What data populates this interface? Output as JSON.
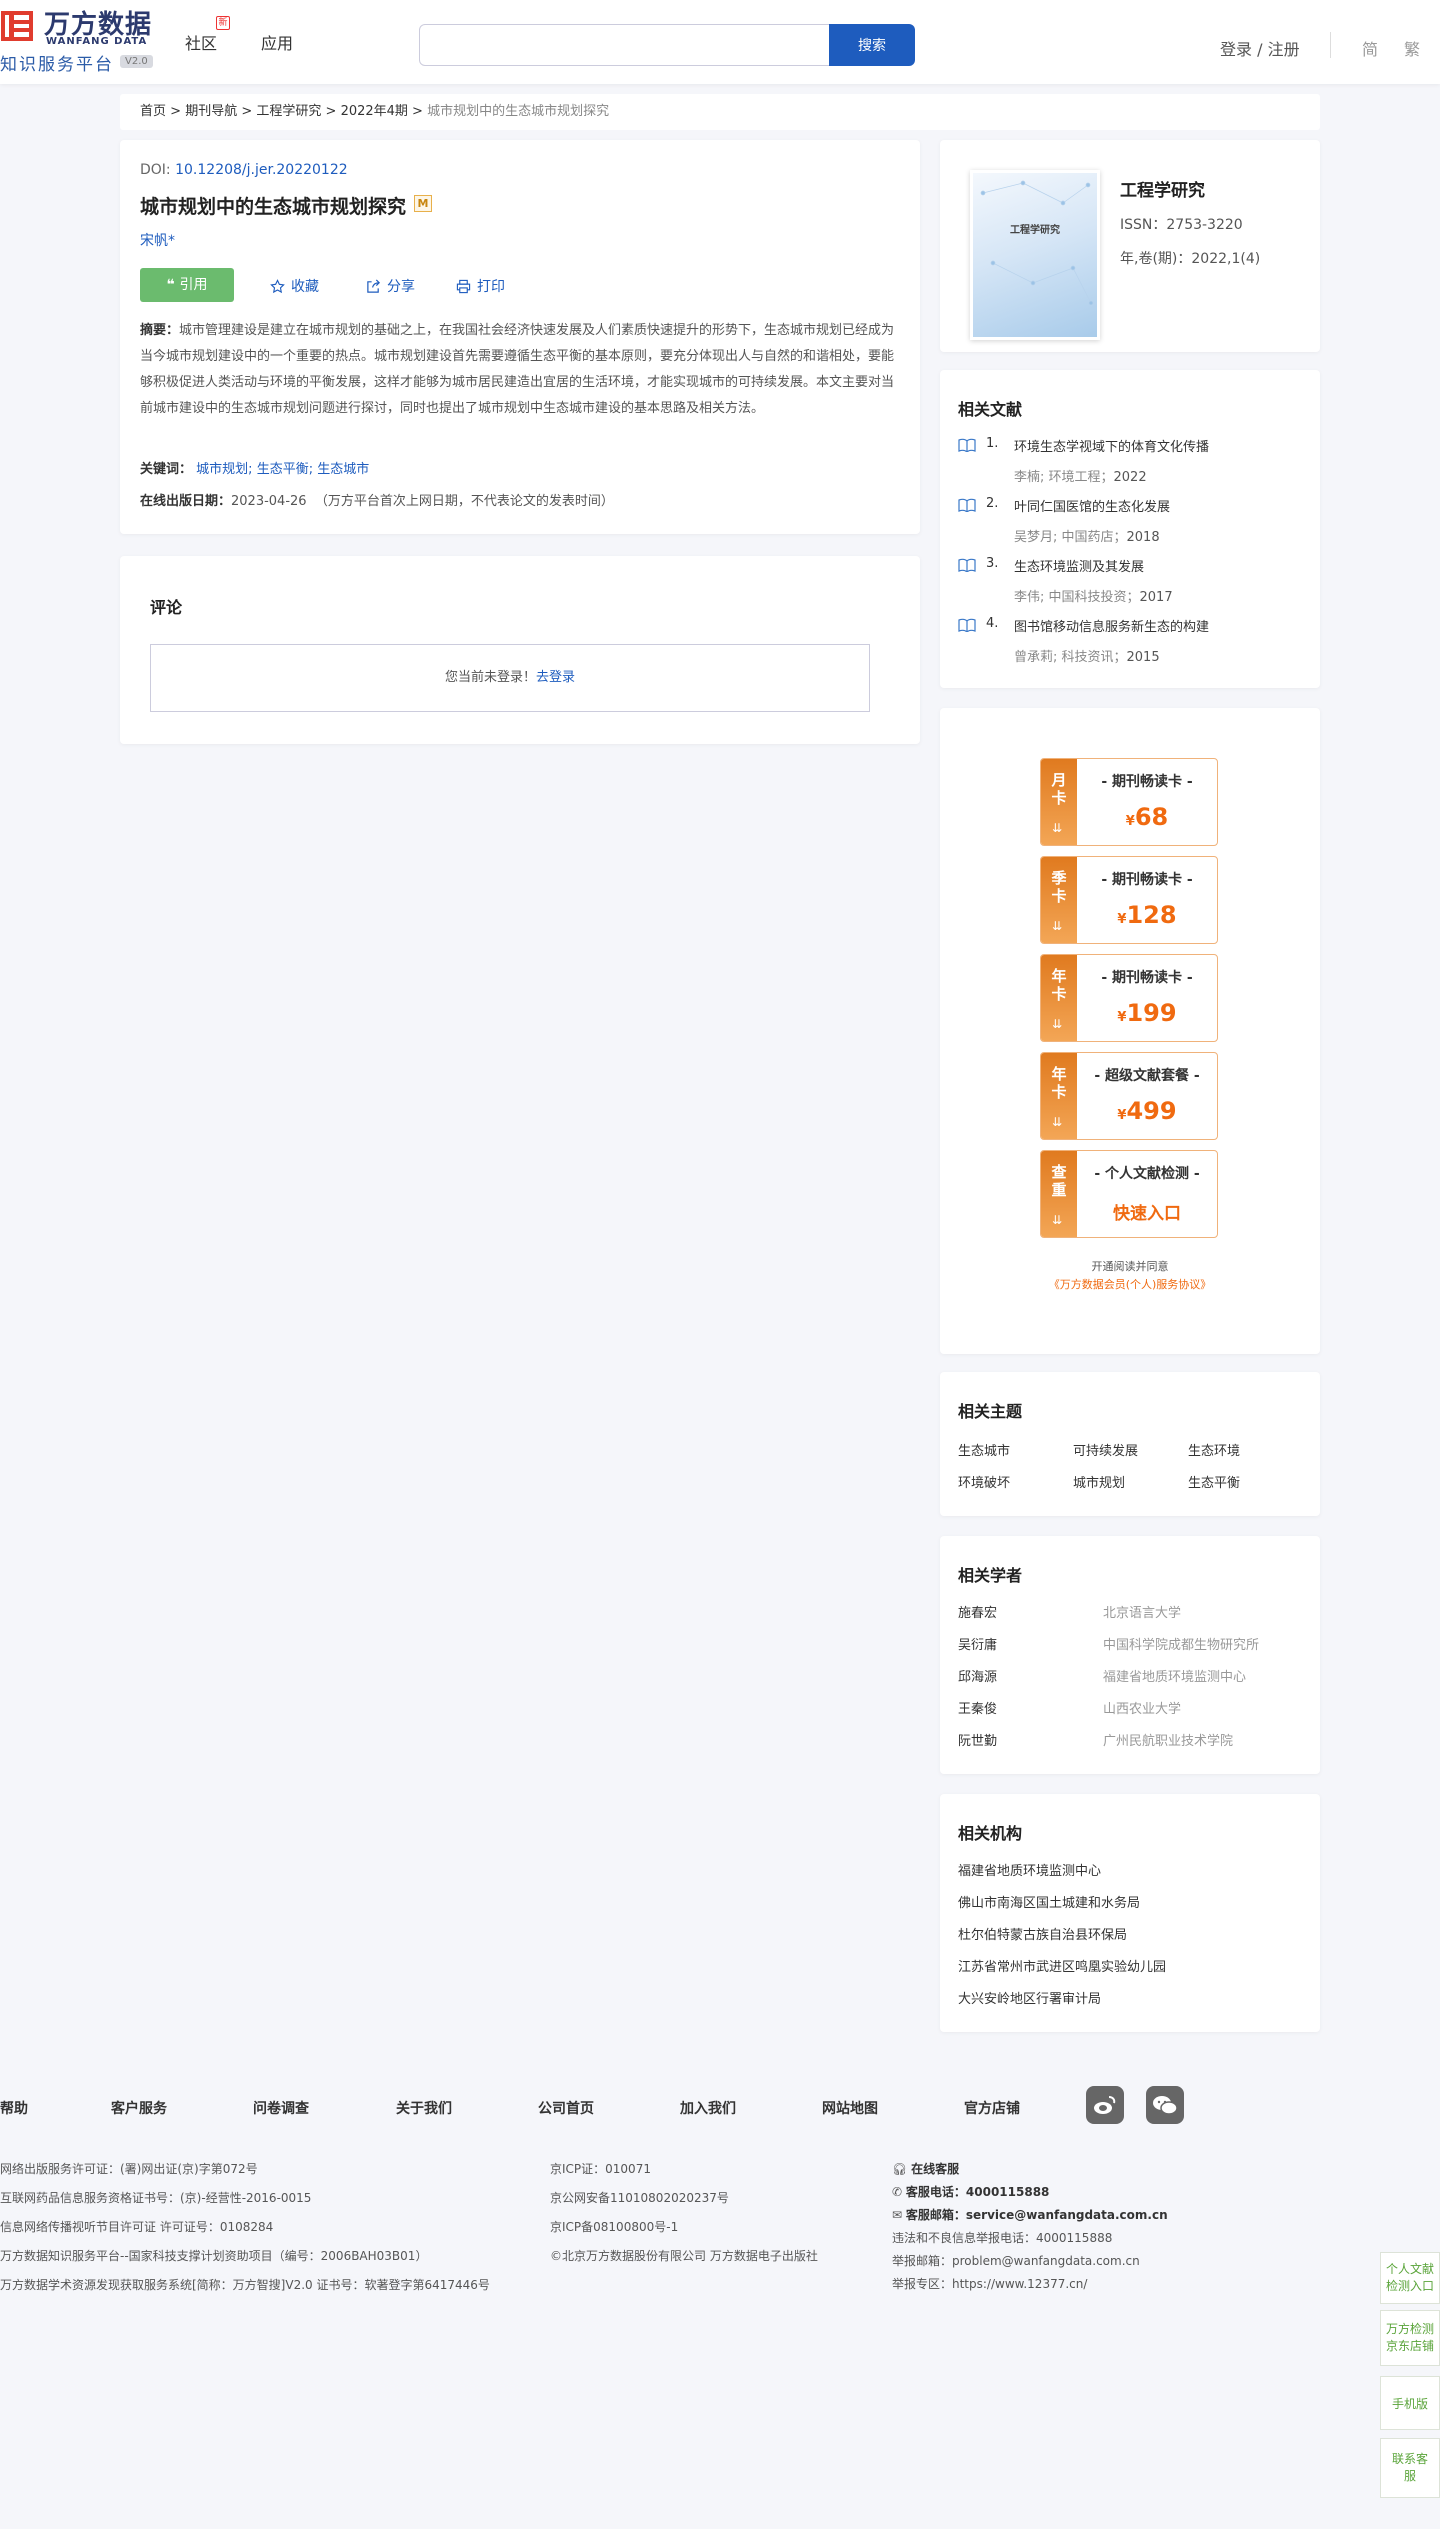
{
  "header": {
    "logo_cn": "万方数据",
    "logo_en": "WANFANG DATA",
    "logo_sub": "知识服务平台",
    "logo_version": "V2.0",
    "nav": [
      "社区",
      "应用"
    ],
    "nav_badge": "新",
    "search_value": "",
    "search_button": "搜索",
    "login": "登录 / 注册",
    "lang_simplified": "简",
    "lang_traditional": "繁"
  },
  "breadcrumb": {
    "items": [
      "首页",
      "期刊导航",
      "工程学研究",
      "2022年4期"
    ],
    "current": "城市规划中的生态城市规划探究"
  },
  "article": {
    "doi_label": "DOI: ",
    "doi": "10.12208/j.jer.20220122",
    "title": "城市规划中的生态城市规划探究",
    "badge": "M",
    "author": "宋帆*",
    "cite": "引用",
    "collect": "收藏",
    "share": "分享",
    "print": "打印",
    "abstract_label": "摘要：",
    "abstract": "城市管理建设是建立在城市规划的基础之上，在我国社会经济快速发展及人们素质快速提升的形势下，生态城市规划已经成为当今城市规划建设中的一个重要的热点。城市规划建设首先需要遵循生态平衡的基本原则，要充分体现出人与自然的和谐相处，要能够积极促进人类活动与环境的平衡发展，这样才能够为城市居民建造出宜居的生活环境，才能实现城市的可持续发展。本文主要对当前城市建设中的生态城市规划问题进行探讨，同时也提出了城市规划中生态城市建设的基本思路及相关方法。",
    "keywords_label": "关键词：",
    "keywords": [
      "城市规划",
      "生态平衡",
      "生态城市"
    ],
    "pubdate_label": "在线出版日期：",
    "pubdate": "2023-04-26",
    "pubdate_note": "（万方平台首次上网日期，不代表论文的发表时间）"
  },
  "comments": {
    "title": "评论",
    "not_logged": "您当前未登录！",
    "login_link": "去登录"
  },
  "journal": {
    "cover_title": "工程学研究",
    "name": "工程学研究",
    "issn": "ISSN：2753-3220",
    "issue": "年,卷(期)：2022,1(4)"
  },
  "related_literature": {
    "title": "相关文献",
    "items": [
      {
        "num": "1.",
        "title": "环境生态学视域下的体育文化传播",
        "authors": "李楠; 环境工程；",
        "year": "2022"
      },
      {
        "num": "2.",
        "title": "叶同仁国医馆的生态化发展",
        "authors": "吴梦月; 中国药店；",
        "year": "2018"
      },
      {
        "num": "3.",
        "title": "生态环境监测及其发展",
        "authors": "李伟; 中国科技投资；",
        "year": "2017"
      },
      {
        "num": "4.",
        "title": "图书馆移动信息服务新生态的构建",
        "authors": "曾承莉; 科技资讯；",
        "year": "2015"
      }
    ]
  },
  "promo": {
    "items": [
      {
        "tag": [
          "月",
          "卡"
        ],
        "name": "- 期刊畅读卡 -",
        "yen": "¥",
        "price": "68"
      },
      {
        "tag": [
          "季",
          "卡"
        ],
        "name": "- 期刊畅读卡 -",
        "yen": "¥",
        "price": "128"
      },
      {
        "tag": [
          "年",
          "卡"
        ],
        "name": "- 期刊畅读卡 -",
        "yen": "¥",
        "price": "199"
      },
      {
        "tag": [
          "年",
          "卡"
        ],
        "name": "- 超级文献套餐 -",
        "yen": "¥",
        "price": "499"
      }
    ],
    "check": {
      "tag": [
        "查",
        "重"
      ],
      "name": "- 个人文献检测 -",
      "action": "快速入口"
    },
    "note": "开通阅读并同意",
    "agreement": "《万方数据会员(个人)服务协议》"
  },
  "related_topics": {
    "title": "相关主题",
    "items": [
      "生态城市",
      "可持续发展",
      "生态环境",
      "环境破坏",
      "城市规划",
      "生态平衡"
    ]
  },
  "related_scholars": {
    "title": "相关学者",
    "items": [
      {
        "name": "施春宏",
        "org": "北京语言大学"
      },
      {
        "name": "吴衍庸",
        "org": "中国科学院成都生物研究所"
      },
      {
        "name": "邱海源",
        "org": "福建省地质环境监测中心"
      },
      {
        "name": "王秦俊",
        "org": "山西农业大学"
      },
      {
        "name": "阮世勤",
        "org": "广州民航职业技术学院"
      }
    ]
  },
  "related_institutions": {
    "title": "相关机构",
    "items": [
      "福建省地质环境监测中心",
      "佛山市南海区国土城建和水务局",
      "杜尔伯特蒙古族自治县环保局",
      "江苏省常州市武进区鸣凰实验幼儿园",
      "大兴安岭地区行署审计局"
    ]
  },
  "footer": {
    "nav": [
      "帮助",
      "客户服务",
      "问卷调查",
      "关于我们",
      "公司首页",
      "加入我们",
      "网站地图",
      "官方店铺"
    ],
    "col1": [
      "网络出版服务许可证：(署)网出证(京)字第072号",
      "互联网药品信息服务资格证书号：(京)-经营性-2016-0015",
      "信息网络传播视听节目许可证 许可证号：0108284",
      "万方数据知识服务平台--国家科技支撑计划资助项目（编号：2006BAH03B01）",
      "万方数据学术资源发现获取服务系统[简称：万方智搜]V2.0 证书号：软著登字第6417446号"
    ],
    "col2": [
      "京ICP证：010071",
      "京公网安备11010802020237号",
      "京ICP备08100800号-1",
      "©北京万方数据股份有限公司 万方数据电子出版社"
    ],
    "service": "在线客服",
    "phone_label": "客服电话：",
    "phone": "4000115888",
    "email_label": "客服邮箱：",
    "email": "service@wanfangdata.com.cn",
    "report_phone": "违法和不良信息举报电话：4000115888",
    "report_email": "举报邮箱：problem@wanfangdata.com.cn",
    "report_zone": "举报专区：https://www.12377.cn/"
  },
  "floating": {
    "items": [
      "个人文献检测入口",
      "万方检测京东店铺",
      "手机版",
      "联系客服"
    ]
  }
}
